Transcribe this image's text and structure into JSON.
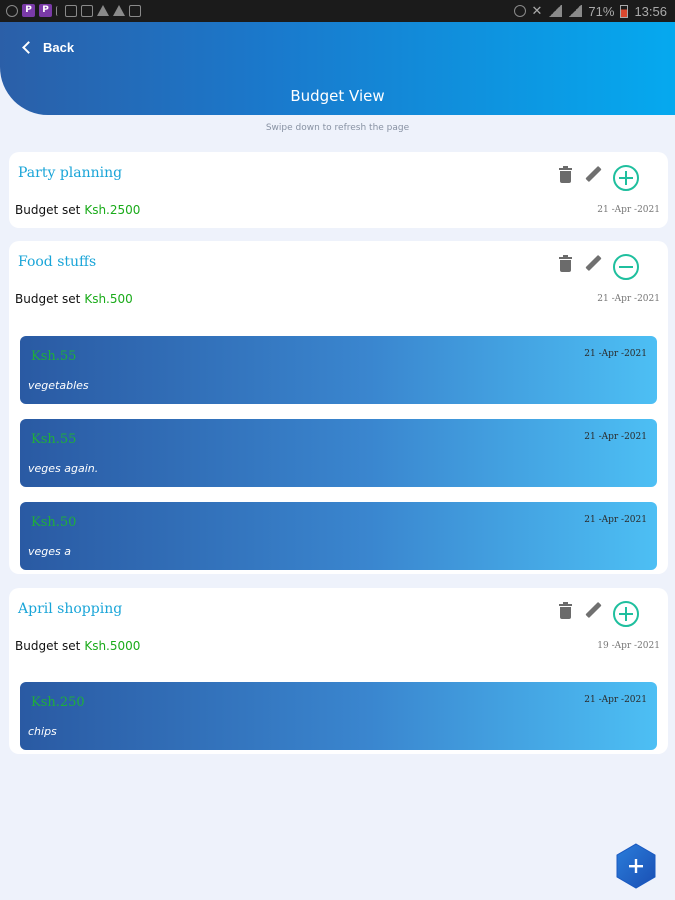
{
  "status_bar": {
    "battery": "71%",
    "time": "13:56"
  },
  "header": {
    "back_label": "Back",
    "title": "Budget View"
  },
  "hint": "Swipe down to refresh the page",
  "budget_label": "Budget set",
  "budgets": [
    {
      "title": "Party planning",
      "amount": "Ksh.2500",
      "date": "21 -Apr -2021",
      "toggle": "expand",
      "expenses": []
    },
    {
      "title": "Food stuffs",
      "amount": "Ksh.500",
      "date": "21 -Apr -2021",
      "toggle": "collapse",
      "expenses": [
        {
          "amount": "Ksh.55",
          "date": "21 -Apr -2021",
          "description": "vegetables"
        },
        {
          "amount": "Ksh.55",
          "date": "21 -Apr -2021",
          "description": "veges again."
        },
        {
          "amount": "Ksh.50",
          "date": "21 -Apr -2021",
          "description": "veges a"
        }
      ]
    },
    {
      "title": "April shopping",
      "amount": "Ksh.5000",
      "date": "19 -Apr -2021",
      "toggle": "expand",
      "expenses": [
        {
          "amount": "Ksh.250",
          "date": "21 -Apr -2021",
          "description": "chips"
        }
      ]
    }
  ],
  "colors": {
    "accent": "#1aa5d8",
    "amount_green": "#1aab1a",
    "toggle_teal": "#1fbf9e"
  },
  "fab_icon": "plus-icon"
}
